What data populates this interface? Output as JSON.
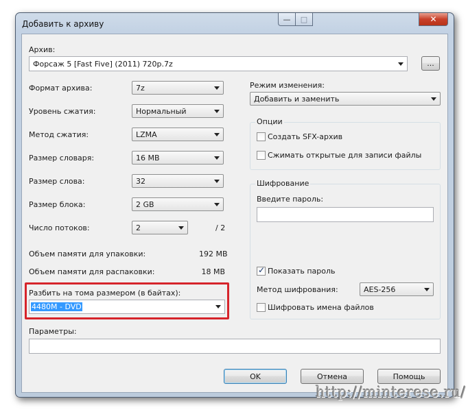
{
  "window": {
    "title": "Добавить к архиву",
    "minimize": "—",
    "maximize": "□",
    "close": "✕"
  },
  "archive": {
    "label": "Архив:",
    "value": "Форсаж 5 [Fast Five] (2011) 720p.7z",
    "browse_label": "..."
  },
  "left": {
    "format_label": "Формат архива:",
    "format_value": "7z",
    "level_label": "Уровень сжатия:",
    "level_value": "Нормальный",
    "method_label": "Метод сжатия:",
    "method_value": "LZMA",
    "dict_label": "Размер словаря:",
    "dict_value": "16 MB",
    "word_label": "Размер слова:",
    "word_value": "32",
    "block_label": "Размер блока:",
    "block_value": "2 GB",
    "threads_label": "Число потоков:",
    "threads_value": "2",
    "threads_max": "/ 2",
    "mem_pack_label": "Объем памяти для упаковки:",
    "mem_pack_value": "192 MB",
    "mem_unpack_label": "Объем памяти для распаковки:",
    "mem_unpack_value": "18 MB",
    "split_label": "Разбить на тома размером (в байтах):",
    "split_value": "4480M - DVD",
    "params_label": "Параметры:",
    "params_value": ""
  },
  "right": {
    "update_label": "Режим изменения:",
    "update_value": "Добавить и заменить",
    "options_legend": "Опции",
    "sfx_label": "Создать SFX-архив",
    "sfx_checked": false,
    "shared_label": "Сжимать открытые для записи файлы",
    "shared_checked": false,
    "enc_legend": "Шифрование",
    "password_label": "Введите пароль:",
    "password_value": "",
    "show_password_label": "Показать пароль",
    "show_password_checked": true,
    "enc_method_label": "Метод шифрования:",
    "enc_method_value": "AES-256",
    "enc_names_label": "Шифровать имена файлов",
    "enc_names_checked": false
  },
  "buttons": {
    "ok": "OK",
    "cancel": "Отмена",
    "help": "Помощь"
  },
  "watermark": "http://minterese.ru/",
  "colors": {
    "highlight_box": "#d6242b",
    "selection": "#3399ff"
  }
}
